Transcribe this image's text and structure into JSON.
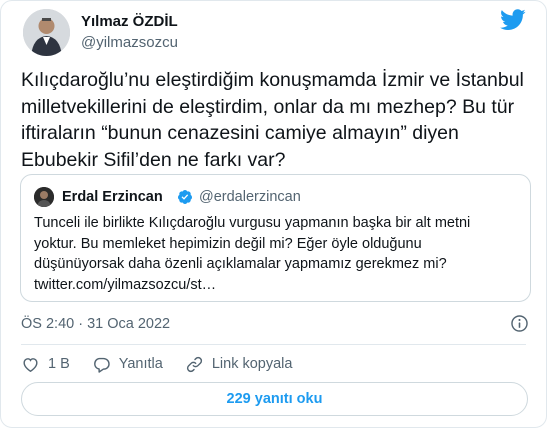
{
  "author": {
    "name": "Yılmaz ÖZDİL",
    "handle": "@yilmazsozcu"
  },
  "tweet": {
    "text": "Kılıçdaroğlu’nu eleştirdiğim konuşmamda İzmir ve İstanbul milletvekillerini de eleştirdim, onlar da mı mezhep? Bu tür iftiraların “bunun cenazesini camiye almayın” diyen Ebubekir Sifil’den ne farkı var?"
  },
  "quote": {
    "name": "Erdal Erzincan",
    "handle": "@erdalerzincan",
    "lines": [
      "Tunceli ile birlikte Kılıçdaroğlu vurgusu yapmanın başka bir alt metni",
      "yoktur. Bu memleket hepimizin  değil mi? Eğer öyle olduğunu",
      "düşünüyorsak  daha özenli açıklamalar yapmamız gerekmez mi?",
      "twitter.com/yilmazsozcu/st…"
    ]
  },
  "meta": {
    "timestamp": "ÖS 2:40 · 31 Oca 2022"
  },
  "actions": {
    "like_count": "1 B",
    "reply_label": "Yanıtla",
    "copy_link_label": "Link kopyala"
  },
  "footer": {
    "read_replies_label": "229 yanıtı oku"
  },
  "colors": {
    "accent": "#1d9bf0",
    "secondary_text": "#536471",
    "border": "#cfd9de"
  },
  "icons": [
    "twitter-bird-icon",
    "verified-badge-icon",
    "info-icon",
    "heart-icon",
    "reply-icon",
    "link-icon"
  ]
}
